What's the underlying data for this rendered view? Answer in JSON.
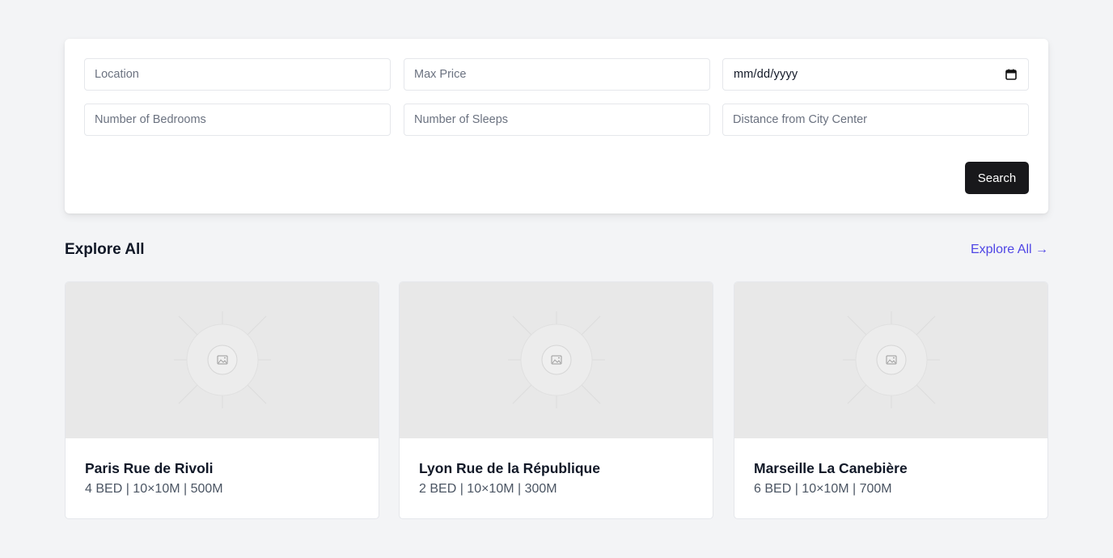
{
  "search": {
    "location_placeholder": "Location",
    "max_price_placeholder": "Max Price",
    "date_placeholder": "mm/dd/yyyy",
    "bedrooms_placeholder": "Number of Bedrooms",
    "sleeps_placeholder": "Number of Sleeps",
    "distance_placeholder": "Distance from City Center",
    "button_label": "Search"
  },
  "section": {
    "title": "Explore All",
    "link_label": "Explore All →"
  },
  "listings": [
    {
      "title": "Paris Rue de Rivoli",
      "meta": "4 BED | 10×10M | 500M"
    },
    {
      "title": "Lyon Rue de la République",
      "meta": "2 BED | 10×10M | 300M"
    },
    {
      "title": "Marseille La Canebière",
      "meta": "6 BED | 10×10M | 700M"
    }
  ],
  "colors": {
    "background": "#f3f4f6",
    "button": "#18181b",
    "link": "#4f46e5",
    "placeholder_image": "#e8e8e8"
  },
  "icons": {
    "calendar": "calendar-icon",
    "image_placeholder": "image-placeholder-icon"
  }
}
